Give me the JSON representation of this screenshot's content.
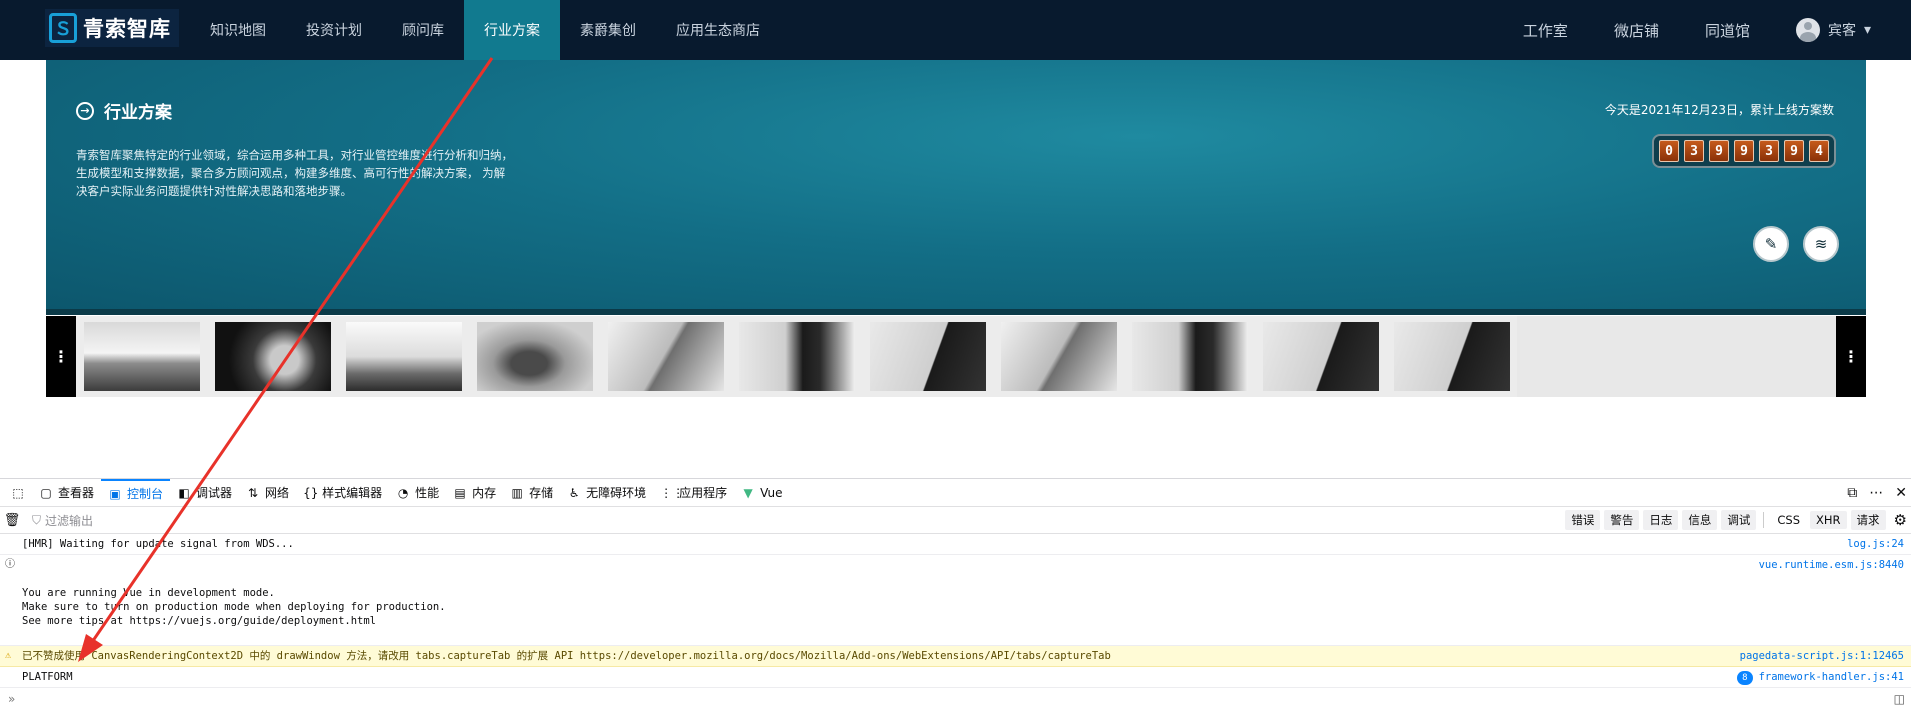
{
  "nav": {
    "logo_mark": "Ｓ",
    "logo_text": "青索智库",
    "items": [
      "知识地图",
      "投资计划",
      "顾问库",
      "行业方案",
      "素爵集创",
      "应用生态商店"
    ],
    "active_index": 3,
    "right": [
      "工作室",
      "微店铺",
      "同道馆"
    ],
    "user": "宾客",
    "user_caret": "▾"
  },
  "hero": {
    "title_icon": "→",
    "title": "行业方案",
    "description": "青索智库聚焦特定的行业领域，综合运用多种工具，对行业管控维度进行分析和归纳， 生成模型和支撑数据，聚合多方顾问观点，构建多维度、高可行性的解决方案， 为解决客户实际业务问题提供针对性解决思路和落地步骤。",
    "date_text": "今天是2021年12月23日，累计上线方案数",
    "counter_digits": [
      "0",
      "3",
      "9",
      "9",
      "3",
      "9",
      "4"
    ],
    "btn_edit_icon": "✎",
    "btn_layers_icon": "≋"
  },
  "gallery": {
    "left_handle": "⋮",
    "right_handle": "⋮",
    "thumbs": [
      "bridge",
      "face",
      "island",
      "whale",
      "peak",
      "woman",
      "building",
      "peak",
      "woman",
      "building",
      "building"
    ]
  },
  "devtools": {
    "tabs": [
      {
        "icon": "▢",
        "label": "查看器"
      },
      {
        "icon": "▣",
        "label": "控制台"
      },
      {
        "icon": "◧",
        "label": "调试器"
      },
      {
        "icon": "⇅",
        "label": "网络"
      },
      {
        "icon": "{}",
        "label": "样式编辑器"
      },
      {
        "icon": "◔",
        "label": "性能"
      },
      {
        "icon": "▤",
        "label": "内存"
      },
      {
        "icon": "▥",
        "label": "存储"
      },
      {
        "icon": "♿",
        "label": "无障碍环境"
      },
      {
        "icon": "⋮⋮",
        "label": "应用程序"
      },
      {
        "icon": "▼",
        "label": "Vue"
      }
    ],
    "active_tab": 1,
    "right_icons": [
      "⧉",
      "⋯",
      "✕"
    ],
    "filter_placeholder": "过滤输出",
    "levels": [
      "错误",
      "警告",
      "日志",
      "信息",
      "调试"
    ],
    "types": [
      "CSS",
      "XHR",
      "请求"
    ],
    "messages": [
      {
        "icon": "",
        "text": "[HMR] Waiting for update signal from WDS...",
        "loc": "log.js:24"
      },
      {
        "icon": "ⓘ",
        "text": "You are running Vue in development mode.\nMake sure to turn on production mode when deploying for production.\nSee more tips at https://vuejs.org/guide/deployment.html",
        "loc": "vue.runtime.esm.js:8440"
      },
      {
        "icon": "⚠",
        "text": "已不赞成使用 CanvasRenderingContext2D 中的 drawWindow 方法，请改用 tabs.captureTab 的扩展 API https://developer.mozilla.org/docs/Mozilla/Add-ons/WebExtensions/API/tabs/captureTab",
        "loc": "pagedata-script.js:1:12465"
      },
      {
        "icon": "",
        "text": "PLATFORM",
        "loc": "framework-handler.js:41",
        "badge": "8"
      }
    ],
    "prompt_icon": "»",
    "split_icon": "◫"
  },
  "colors": {
    "nav_bg": "#081a2e",
    "active_tab": "#117a8f",
    "hero": "#136f87",
    "arrow": "#e8322a"
  }
}
